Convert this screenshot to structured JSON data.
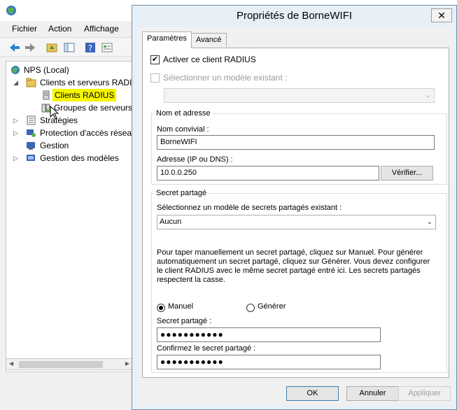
{
  "mmc": {
    "menu": {
      "file": "Fichier",
      "action": "Action",
      "view": "Affichage"
    },
    "tree": {
      "root": "NPS (Local)",
      "clients_servers": "Clients et serveurs RADIUS",
      "radius_clients": "Clients RADIUS",
      "server_groups": "Groupes de serveurs RADIUS distants",
      "policies": "Stratégies",
      "nap": "Protection d'accès réseau",
      "management": "Gestion",
      "templates": "Gestion des modèles"
    }
  },
  "dialog": {
    "title": "Propriétés de BorneWIFI",
    "close_symbol": "✕",
    "tabs": {
      "settings": "Paramètres",
      "advanced": "Avancé"
    },
    "enable_client_label": "Activer ce client RADIUS",
    "enable_client_checked": true,
    "select_template_label": "Sélectionner un modèle existant :",
    "select_template_checked": false,
    "template_value": "",
    "name_group_label": "Nom et adresse",
    "friendly_name_label": "Nom convivial :",
    "friendly_name_value": "BorneWIFI",
    "address_label": "Adresse (IP ou DNS) :",
    "address_value": "10.0.0.250",
    "verify_button": "Vérifier...",
    "secret_group_label": "Secret partagé",
    "secret_template_label": "Sélectionnez un modèle de secrets partagés existant :",
    "secret_template_value": "Aucun",
    "instructions": "Pour taper manuellement un secret partagé, cliquez sur Manuel. Pour générer automatiquement un secret partagé, cliquez sur Générer. Vous devez configurer le client RADIUS avec le même secret partagé entré ici. Les secrets partagés respectent la casse.",
    "manual_label": "Manuel",
    "manual_selected": true,
    "generate_label": "Générer",
    "secret_label": "Secret partagé :",
    "secret_value": "●●●●●●●●●●●",
    "confirm_label": "Confirmez le secret partagé :",
    "confirm_value": "●●●●●●●●●●●",
    "ok_button": "OK",
    "cancel_button": "Annuler",
    "apply_button": "Appliquer"
  }
}
